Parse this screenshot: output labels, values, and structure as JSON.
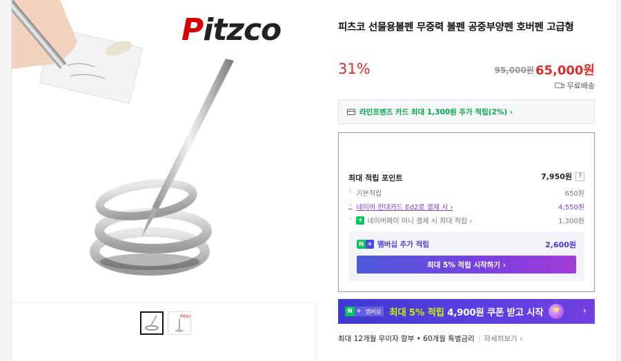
{
  "brand": {
    "logo_text_first": "P",
    "logo_text_rest": "itzco"
  },
  "product": {
    "title": "피츠코 선물용볼펜 무중력 볼펜 공중부양펜 호버펜 고급형",
    "discount": "31%",
    "original_price": "95,000원",
    "sale_price": "65,000원",
    "shipping": "무료배송"
  },
  "card_promo": {
    "text": "라인프렌즈 카드 최대 1,300원 추가 적립(2%) ›"
  },
  "points": {
    "heading": "최대 적립 포인트",
    "total": "7,950원",
    "help": "?",
    "rows": [
      {
        "label": "기본적립",
        "value": "650원"
      },
      {
        "label": "네이버 현대카드 Ed2로 결제 시 ›",
        "value": "4,550원"
      },
      {
        "label": "네이버페이 머니 결제 시 최대 적립 ›",
        "value": "1,300원"
      }
    ],
    "membership": {
      "label": "멤버십 추가 적립",
      "value": "2,600원",
      "button": "최대 5% 적립 시작하기 ›"
    }
  },
  "promo_banner": {
    "badge_n": "N",
    "badge_plus": "+",
    "badge_text": "멤버십",
    "highlight": "최대 5% 적립",
    "rest": " 4,900원 쿠폰 받고 시작",
    "chevron": "›"
  },
  "installment": {
    "text": "최대 12개월 무이자 할부 • 60개월 특별금리",
    "more": "자세히보기 ›"
  },
  "colors": {
    "sale_red": "#e02a2a",
    "naver_green": "#03c75a",
    "membership_purple": "#4a3ad6"
  }
}
